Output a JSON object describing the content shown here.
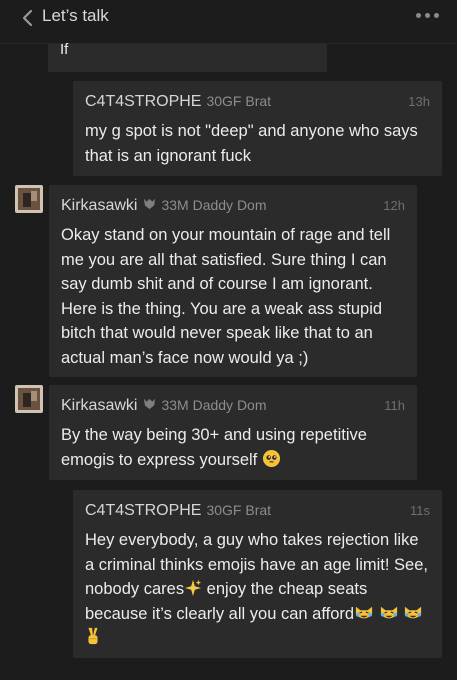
{
  "header": {
    "title": "Let’s talk"
  },
  "messages": [
    {
      "fragment": "If"
    },
    {
      "name": "C4T4STROPHE",
      "tag": "30GF Brat",
      "time": "13h",
      "text": "my g spot is not \"deep\" and anyone who says that is an ignorant fuck"
    },
    {
      "name": "Kirkasawki",
      "tag": "33M Daddy Dom",
      "time": "12h",
      "text": "Okay stand on your mountain of rage and tell me you are all that satisfied. Sure thing I can say dumb shit and of course I am ignorant. Here is the thing. You are a weak ass stupid bitch that would never speak like that to an actual man’s face now would ya ;)"
    },
    {
      "name": "Kirkasawki",
      "tag": "33M Daddy Dom",
      "time": "11h",
      "text": "By the way being 30+ and using repetitive emogis to express yourself"
    },
    {
      "name": "C4T4STROPHE",
      "tag": "30GF Brat",
      "time": "11s",
      "text_a": "Hey everybody, a guy who takes rejection like a criminal thinks emojis have an age limit! See, nobody cares",
      "text_b": "enjoy the cheap seats because it’s clearly all you can afford"
    }
  ],
  "icons": {
    "back": "chevron-left-icon",
    "more": "more-dots-icon",
    "shield": "shield-icon",
    "emoji_pleading": "pleading-face-emoji",
    "emoji_sparkles": "sparkles-emoji",
    "emoji_laugh_cry": "laughing-crying-cat-emoji",
    "emoji_victory": "victory-hand-emoji"
  },
  "colors": {
    "background": "#1c1c1c",
    "bubble": "#2b2b2b",
    "text": "#ececec",
    "muted": "#8d8d8d"
  }
}
